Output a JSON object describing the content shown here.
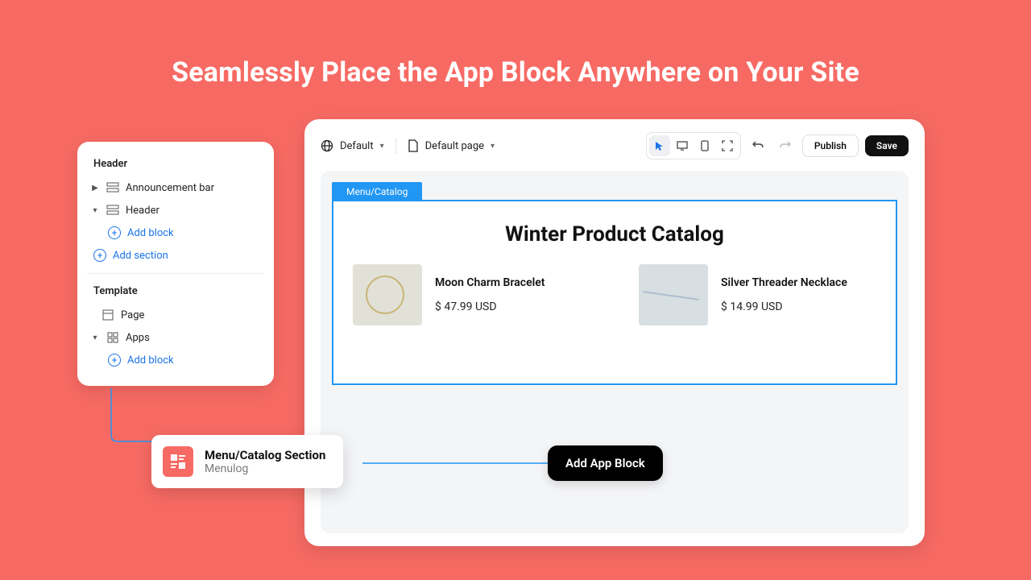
{
  "headline": "Seamlessly Place the App Block Anywhere on Your Site",
  "sidebar": {
    "header_title": "Header",
    "items": [
      {
        "label": "Announcement bar",
        "expanded": false
      },
      {
        "label": "Header",
        "expanded": true
      }
    ],
    "add_block": "Add block",
    "add_section": "Add section",
    "template_title": "Template",
    "template_items": [
      {
        "label": "Page"
      },
      {
        "label": "Apps",
        "expanded": true
      }
    ]
  },
  "topbar": {
    "theme_label": "Default",
    "page_label": "Default page",
    "publish": "Publish",
    "save": "Save"
  },
  "canvas": {
    "tab_label": "Menu/Catalog",
    "catalog_title": "Winter Product Catalog",
    "products": [
      {
        "name": "Moon Charm Bracelet",
        "price": "$ 47.99 USD"
      },
      {
        "name": "Silver Threader Necklace",
        "price": "$ 14.99 USD"
      }
    ]
  },
  "add_block_button": "Add App Block",
  "app_card": {
    "title": "Menu/Catalog Section",
    "subtitle": "Menulog"
  }
}
